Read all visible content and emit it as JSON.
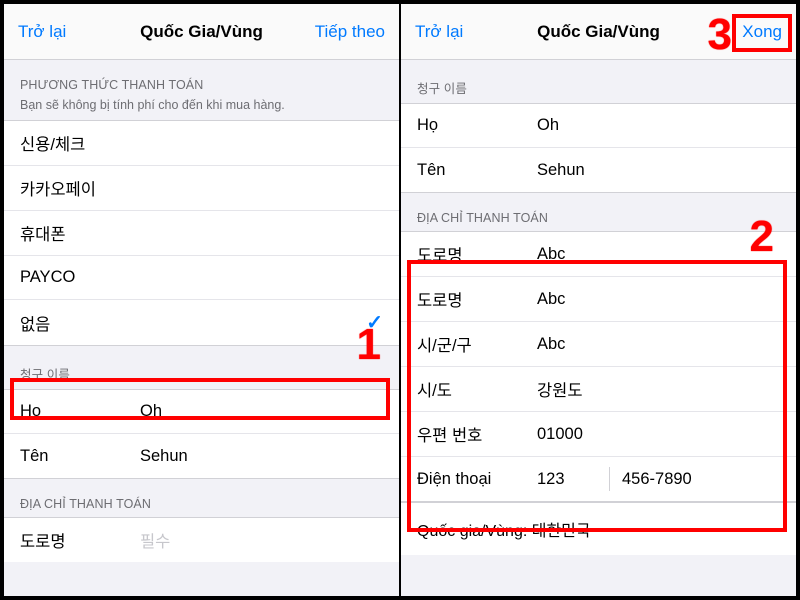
{
  "left": {
    "nav": {
      "back": "Trở lại",
      "title": "Quốc Gia/Vùng",
      "next": "Tiếp theo"
    },
    "payment": {
      "header": "PHƯƠNG THỨC THANH TOÁN",
      "sub": "Bạn sẽ không bị tính phí cho đến khi mua hàng.",
      "options": {
        "o0": "신용/체크",
        "o1": "카카오페이",
        "o2": "휴대폰",
        "o3": "PAYCO",
        "o4": "없음"
      },
      "selected_index": 4
    },
    "billing_name": {
      "header": "청구 이름",
      "surname_label": "Họ",
      "surname_value": "Oh",
      "given_label": "Tên",
      "given_value": "Sehun"
    },
    "billing_addr": {
      "header": "ĐỊA CHỈ THANH TOÁN",
      "street_label": "도로명",
      "street_placeholder": "필수"
    },
    "callout": "1"
  },
  "right": {
    "nav": {
      "back": "Trở lại",
      "title": "Quốc Gia/Vùng",
      "done": "Xong"
    },
    "billing_name": {
      "header": "청구 이름",
      "surname_label": "Họ",
      "surname_value": "Oh",
      "given_label": "Tên",
      "given_value": "Sehun"
    },
    "billing_addr": {
      "header": "ĐỊA CHỈ THANH TOÁN",
      "street1_label": "도로명",
      "street1_value": "Abc",
      "street2_label": "도로명",
      "street2_value": "Abc",
      "district_label": "시/군/구",
      "district_value": "Abc",
      "province_label": "시/도",
      "province_value": "강원도",
      "postal_label": "우편 번호",
      "postal_value": "01000",
      "phone_label": "Điện thoại",
      "phone_area": "123",
      "phone_rest": "456-7890"
    },
    "country_line": "Quốc gia/Vùng: 대한민국",
    "callout_addr": "2",
    "callout_done": "3"
  }
}
